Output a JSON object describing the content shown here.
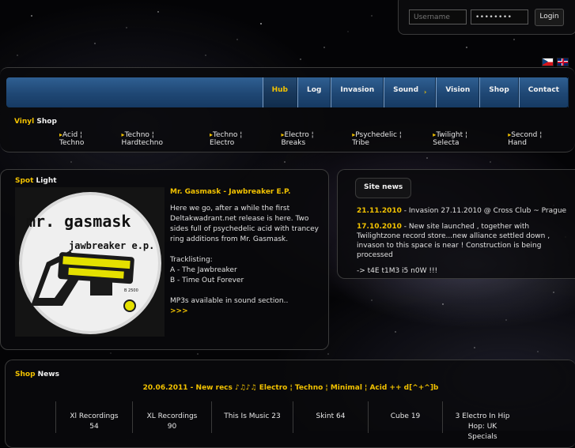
{
  "login": {
    "username_placeholder": "Username",
    "password_value": "••••••••",
    "button_label": "Login"
  },
  "nav": [
    {
      "label": "Hub",
      "active": true
    },
    {
      "label": "Log"
    },
    {
      "label": "Invasion"
    },
    {
      "label": "Sound",
      "arrow": "›"
    },
    {
      "label": "Vision"
    },
    {
      "label": "Shop"
    },
    {
      "label": "Contact"
    }
  ],
  "vinyl_shop": {
    "heading_accent": "Vinyl",
    "heading_rest": " Shop",
    "links": [
      "Acid ¦ Techno",
      "Techno ¦ Hardtechno",
      "Techno ¦ Electro",
      "Electro ¦ Breaks",
      "Psychedelic ¦ Tribe",
      "Twilight ¦ Selecta",
      "Second ¦ Hand"
    ],
    "link_marker": "▸"
  },
  "spotlight": {
    "heading_accent": "Spot",
    "heading_rest": " Light",
    "title": "Mr. Gasmask - Jawbreaker E.P.",
    "p1": "Here we go, after a while the first Deltakwadrant.net release is here. Two sides full of psychedelic acid with trancey ring additions from Mr. Gasmask.",
    "tracklisting": "Tracklisting:",
    "track_a": "A - The Jawbreaker",
    "track_b": "B - Time Out Forever",
    "p3": "MP3s available in sound section..",
    "more": ">>>",
    "album": {
      "line1": "mr. gasmask",
      "line2": "jawbreaker e.p.",
      "code": "B 2500"
    }
  },
  "site_news": {
    "heading": "Site news",
    "items": [
      {
        "date": "21.11.2010",
        "text": " - Invasion 27.11.2010 @ Cross Club ~ Prague"
      },
      {
        "date": "17.10.2010",
        "text": " - New site launched , together with Twilightzone record store...new alliance settled down , invason to this space is near ! Construction is being processed"
      },
      {
        "date": "",
        "text": "-> t4E t1M3 i5 n0W !!!"
      }
    ]
  },
  "shop_news": {
    "heading_accent": "Shop",
    "heading_rest": " News",
    "headline": "20.06.2011 - New recs ♪♫♪♫ Electro ¦ Techno ¦ Minimal ¦ Acid ++ d[^+^]b",
    "labels": [
      "Xl Recordings 54",
      "XL Recordings 90",
      "This Is Music 23",
      "Skint 64",
      "Cube 19",
      "3 Electro In Hip Hop: UK Specials"
    ]
  },
  "colors": {
    "accent": "#f2c200",
    "nav_blue": "#1f4774",
    "panel_border": "#3b3b3b"
  }
}
